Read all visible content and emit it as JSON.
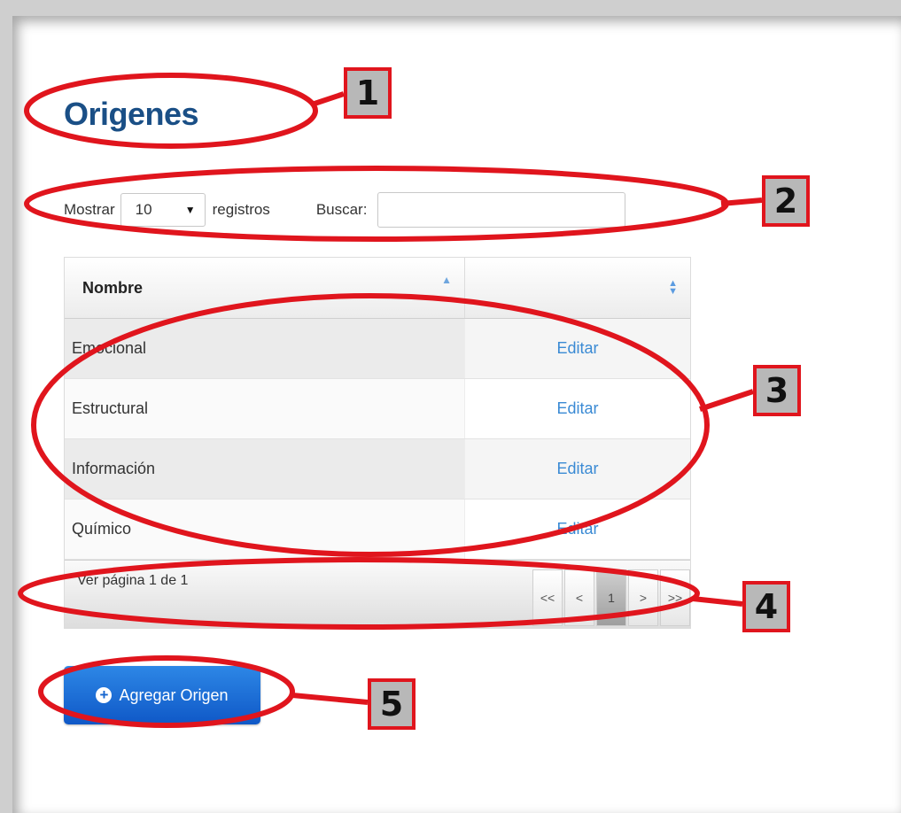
{
  "page": {
    "title": "Origenes"
  },
  "controls": {
    "show_label": "Mostrar",
    "page_size": "10",
    "records_label": "registros",
    "search_label": "Buscar:",
    "search_value": ""
  },
  "table": {
    "columns": [
      "Nombre",
      ""
    ],
    "rows": [
      {
        "name": "Emocional",
        "action": "Editar"
      },
      {
        "name": "Estructural",
        "action": "Editar"
      },
      {
        "name": "Información",
        "action": "Editar"
      },
      {
        "name": "Químico",
        "action": "Editar"
      }
    ],
    "sort_icons": [
      "sort-asc-icon",
      "sort-both-icon"
    ]
  },
  "pagination": {
    "info": "Ver página 1 de 1",
    "buttons": [
      "<<",
      "<",
      "1",
      ">",
      ">>"
    ],
    "current": "1"
  },
  "add_button": {
    "label": "Agregar Origen",
    "icon": "plus-circle-icon"
  },
  "callouts": [
    "1",
    "2",
    "3",
    "4",
    "5"
  ],
  "colors": {
    "title": "#1a4f86",
    "link": "#3a8ad4",
    "button": "#1565cf",
    "annotation": "#e0151d"
  }
}
